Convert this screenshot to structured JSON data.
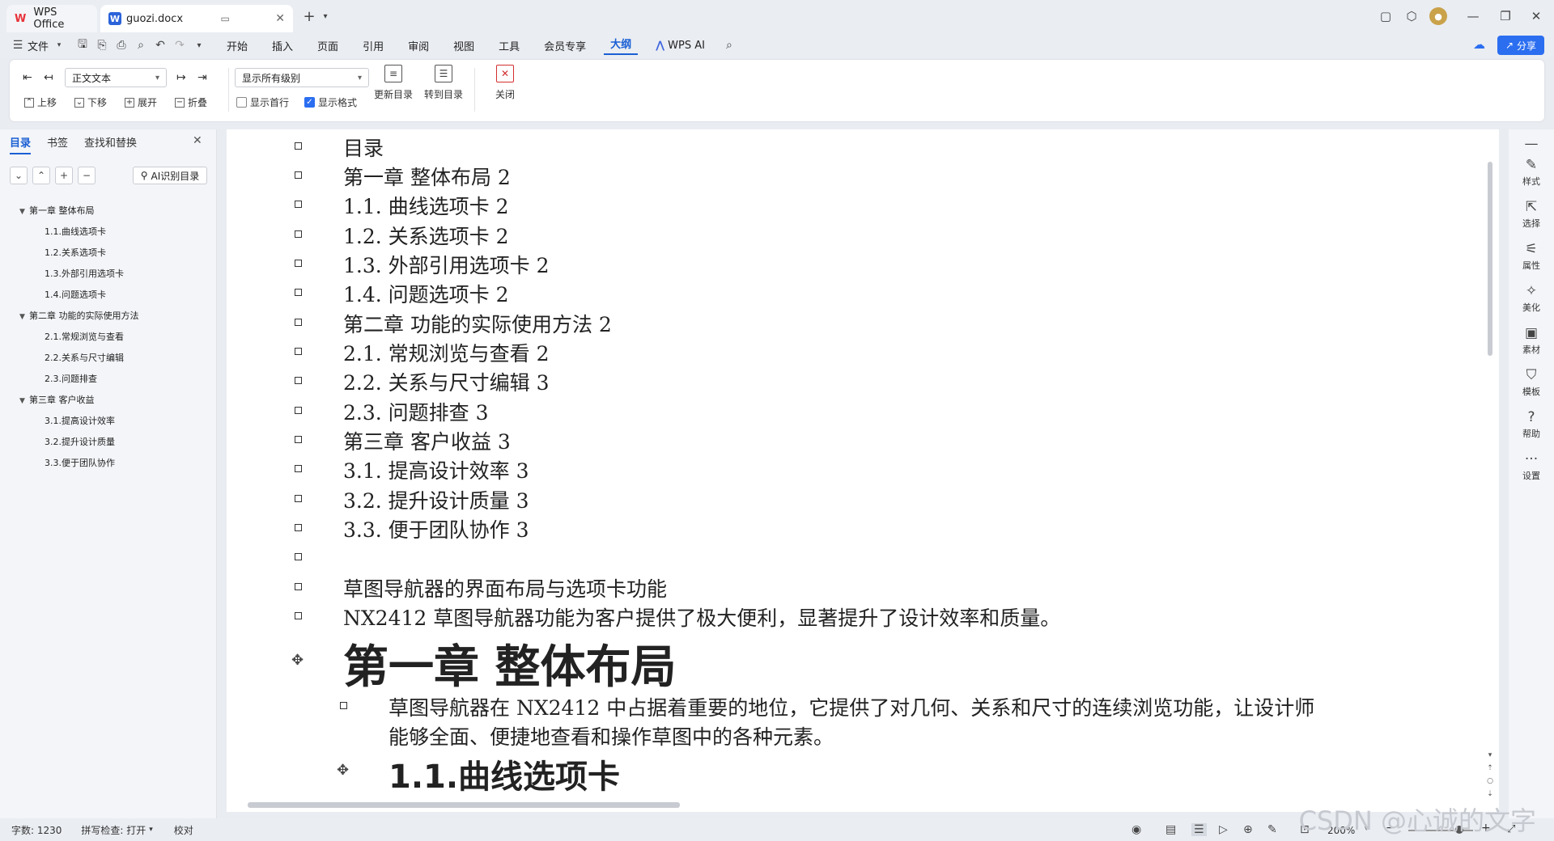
{
  "window": {
    "home_tab": "WPS Office",
    "doc_tab": "guozi.docx",
    "new_tab_symbol": "+"
  },
  "menu": {
    "file": "文件",
    "items": [
      "开始",
      "插入",
      "页面",
      "引用",
      "审阅",
      "视图",
      "工具",
      "会员专享",
      "大纲"
    ],
    "active": "大纲",
    "wps_ai": "WPS AI",
    "share": "分享"
  },
  "ribbon": {
    "style_select": "正文文本",
    "level_select": "显示所有级别",
    "move_up": "上移",
    "move_down": "下移",
    "expand": "展开",
    "collapse": "折叠",
    "show_first_line": "显示首行",
    "show_format": "显示格式",
    "show_first_line_checked": false,
    "show_format_checked": true,
    "update_toc": "更新目录",
    "goto_toc": "转到目录",
    "close": "关闭"
  },
  "left_panel": {
    "tabs": [
      "目录",
      "书签",
      "查找和替换"
    ],
    "active_tab": "目录",
    "ai_button": "AI识别目录",
    "toc": [
      {
        "label": "第一章  整体布局",
        "level": 1
      },
      {
        "label": "1.1.曲线选项卡",
        "level": 2
      },
      {
        "label": "1.2.关系选项卡",
        "level": 2
      },
      {
        "label": "1.3.外部引用选项卡",
        "level": 2
      },
      {
        "label": "1.4.问题选项卡",
        "level": 2
      },
      {
        "label": "第二章  功能的实际使用方法",
        "level": 1
      },
      {
        "label": "2.1.常规浏览与查看",
        "level": 2
      },
      {
        "label": "2.2.关系与尺寸编辑",
        "level": 2
      },
      {
        "label": "2.3.问题排查",
        "level": 2
      },
      {
        "label": "第三章  客户收益",
        "level": 1
      },
      {
        "label": "3.1.提高设计效率",
        "level": 2
      },
      {
        "label": "3.2.提升设计质量",
        "level": 2
      },
      {
        "label": "3.3.便于团队协作",
        "level": 2
      }
    ]
  },
  "document": {
    "toc_lines": [
      "目录",
      "第一章  整体布局        2",
      "1.1.  曲线选项卡        2",
      "1.2.  关系选项卡        2",
      "1.3.  外部引用选项卡        2",
      "1.4.  问题选项卡        2",
      "第二章  功能的实际使用方法        2",
      "2.1.  常规浏览与查看        2",
      "2.2.  关系与尺寸编辑        3",
      "2.3.  问题排查        3",
      "第三章  客户收益        3",
      "3.1.  提高设计效率        3",
      "3.2.  提升设计质量        3",
      "3.3.  便于团队协作        3",
      ""
    ],
    "intro_title": "草图导航器的界面布局与选项卡功能",
    "intro_text": "NX2412 草图导航器功能为客户提供了极大便利，显著提升了设计效率和质量。",
    "chapter1_heading": "第一章  整体布局",
    "chapter1_para_line1": "草图导航器在 NX2412 中占据着重要的地位，它提供了对几何、关系和尺寸的连续浏览功能，让设计师",
    "chapter1_para_line2": "能够全面、便捷地查看和操作草图中的各种元素。",
    "section11_heading": "1.1.曲线选项卡"
  },
  "right_sidebar": [
    "样式",
    "选择",
    "属性",
    "美化",
    "素材",
    "模板",
    "帮助",
    "设置"
  ],
  "status": {
    "word_count": "字数: 1230",
    "spell_check": "拼写检查: 打开",
    "proofread": "校对",
    "zoom": "200%"
  },
  "watermark": "CSDN @心诚的文字"
}
